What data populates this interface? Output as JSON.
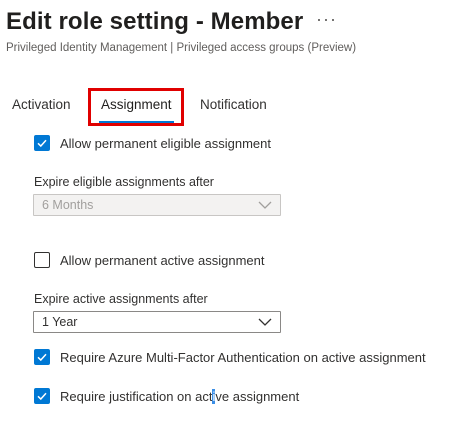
{
  "header": {
    "title": "Edit role setting - Member",
    "more_label": "···",
    "subtitle": "Privileged Identity Management | Privileged access groups (Preview)"
  },
  "tabs": [
    {
      "label": "Activation",
      "selected": false
    },
    {
      "label": "Assignment",
      "selected": true
    },
    {
      "label": "Notification",
      "selected": false
    }
  ],
  "settings": {
    "permanent_eligible": {
      "label": "Allow permanent eligible assignment",
      "checked": true
    },
    "expire_eligible": {
      "label": "Expire eligible assignments after",
      "value": "6 Months",
      "disabled": true
    },
    "permanent_active": {
      "label": "Allow permanent active assignment",
      "checked": false
    },
    "expire_active": {
      "label": "Expire active assignments after",
      "value": "1 Year",
      "disabled": false
    },
    "require_mfa": {
      "label": "Require Azure Multi-Factor Authentication on active assignment",
      "checked": true
    },
    "require_justification": {
      "label_before": "Require justification on act",
      "label_highlight": "i",
      "label_after": "ve assignment",
      "checked": true
    }
  },
  "colors": {
    "accent": "#0078d4",
    "highlight_box": "#e00000",
    "text": "#323130"
  }
}
